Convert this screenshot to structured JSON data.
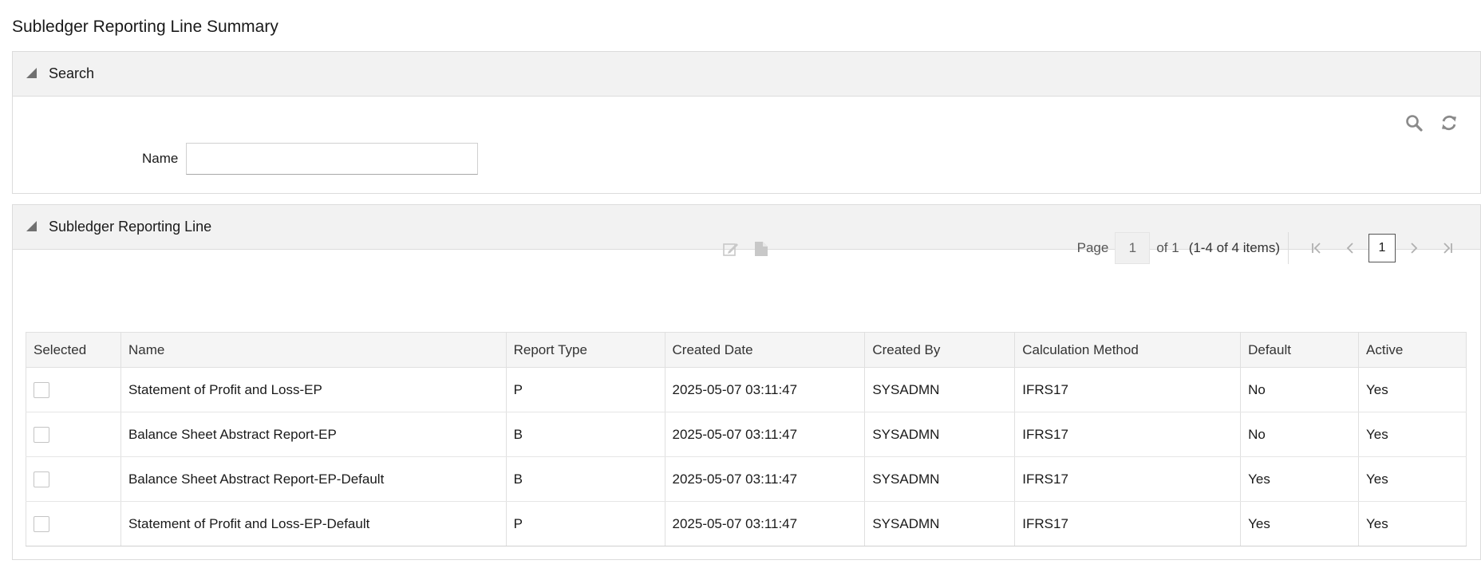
{
  "page": {
    "title": "Subledger Reporting Line Summary"
  },
  "search_panel": {
    "title": "Search",
    "name_label": "Name",
    "name_value": "",
    "name_placeholder": ""
  },
  "list_panel": {
    "title": "Subledger Reporting Line",
    "pager": {
      "page_label": "Page",
      "page_value": "1",
      "of_label": "of 1",
      "items_label": "(1-4 of 4 items)",
      "current_page": "1"
    },
    "columns": [
      "Selected",
      "Name",
      "Report Type",
      "Created Date",
      "Created By",
      "Calculation Method",
      "Default",
      "Active"
    ],
    "rows": [
      {
        "name": "Statement of Profit and Loss-EP",
        "report_type": "P",
        "created_date": "2025-05-07 03:11:47",
        "created_by": "SYSADMN",
        "calc_method": "IFRS17",
        "default": "No",
        "active": "Yes"
      },
      {
        "name": "Balance Sheet Abstract Report-EP",
        "report_type": "B",
        "created_date": "2025-05-07 03:11:47",
        "created_by": "SYSADMN",
        "calc_method": "IFRS17",
        "default": "No",
        "active": "Yes"
      },
      {
        "name": "Balance Sheet Abstract Report-EP-Default",
        "report_type": "B",
        "created_date": "2025-05-07 03:11:47",
        "created_by": "SYSADMN",
        "calc_method": "IFRS17",
        "default": "Yes",
        "active": "Yes"
      },
      {
        "name": "Statement of Profit and Loss-EP-Default",
        "report_type": "P",
        "created_date": "2025-05-07 03:11:47",
        "created_by": "SYSADMN",
        "calc_method": "IFRS17",
        "default": "Yes",
        "active": "Yes"
      }
    ]
  },
  "icons": {
    "search": "search-icon",
    "reset": "refresh-icon",
    "edit": "edit-icon",
    "view": "document-icon",
    "first": "first-page-icon",
    "prev": "previous-page-icon",
    "next": "next-page-icon",
    "last": "last-page-icon"
  },
  "colors": {
    "header_bg": "#f2f2f2",
    "icon_gray": "#8a8a8a",
    "disabled_gray": "#c8c8c8"
  }
}
